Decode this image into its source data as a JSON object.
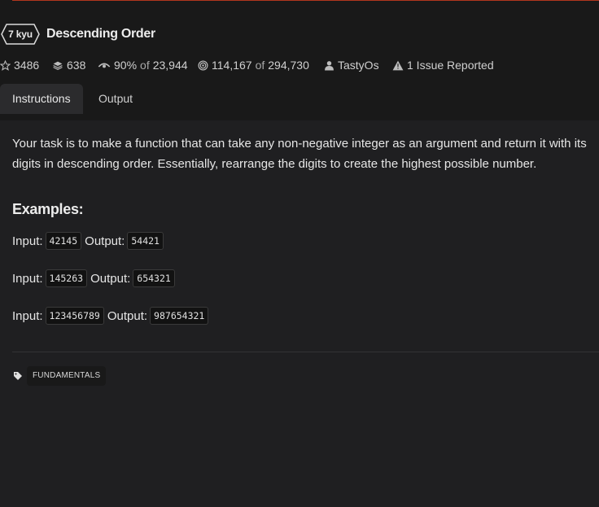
{
  "kata": {
    "rank": "7 kyu",
    "title": "Descending Order"
  },
  "stats": {
    "stars": "3486",
    "collections": "638",
    "satisfaction_pct": "90%",
    "satisfaction_of": "of",
    "satisfaction_votes": "23,944",
    "completed": "114,167",
    "completed_of": "of",
    "attempted": "294,730",
    "author": "TastyOs",
    "issues": "1 Issue Reported"
  },
  "tabs": [
    {
      "label": "Instructions",
      "active": true
    },
    {
      "label": "Output",
      "active": false
    }
  ],
  "instructions": {
    "description": "Your task is to make a function that can take any non-negative integer as an argument and return it with its digits in descending order. Essentially, rearrange the digits to create the highest possible number.",
    "examples_heading": "Examples:",
    "input_label": "Input:",
    "output_label": "Output:",
    "examples": [
      {
        "input": "42145",
        "output": "54421"
      },
      {
        "input": "145263",
        "output": "654321"
      },
      {
        "input": "123456789",
        "output": "987654321"
      }
    ]
  },
  "tags": [
    "FUNDAMENTALS"
  ],
  "icons": {
    "stars": "star-icon",
    "collections": "layers-icon",
    "satisfaction": "eye-icon",
    "completed": "target-icon",
    "author": "user-icon",
    "issues": "warning-icon",
    "tag": "tag-icon"
  },
  "colors": {
    "accent": "#b1361e",
    "background": "#1f1f21",
    "header_background": "#191919"
  }
}
